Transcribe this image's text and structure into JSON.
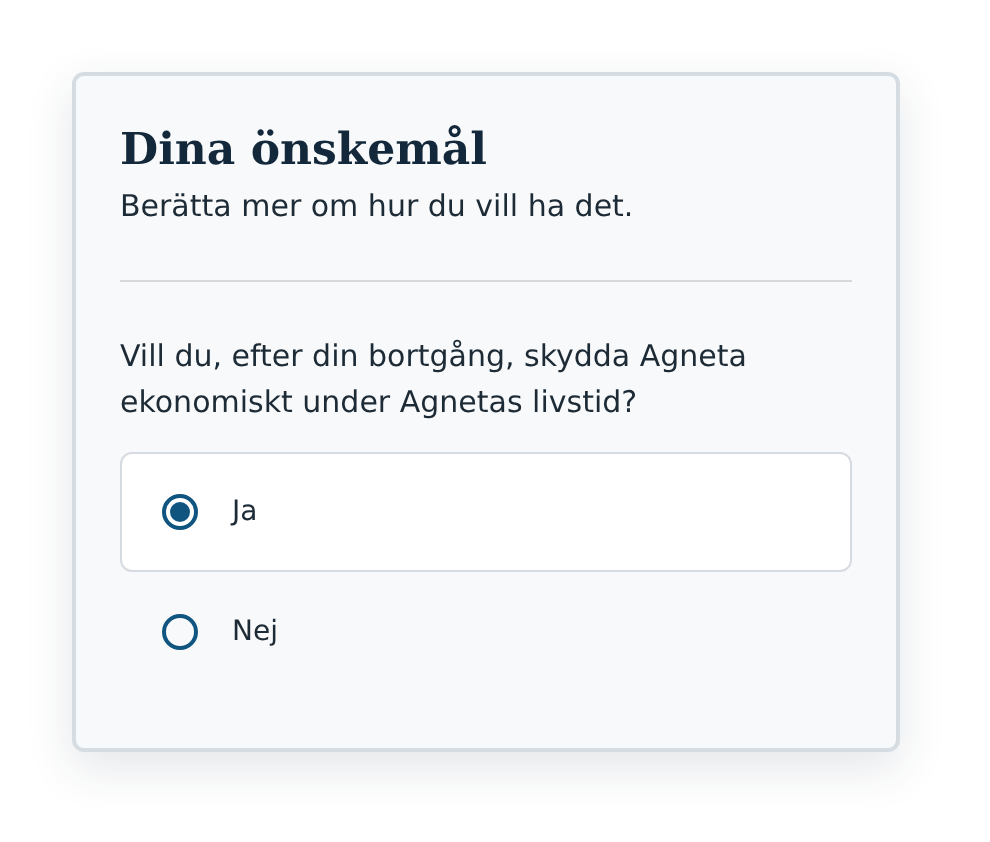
{
  "title": "Dina önskemål",
  "subtitle": "Berätta mer om hur du vill ha det.",
  "question": "Vill du, efter din bortgång, skydda Agneta ekonomiskt under Agnetas livstid?",
  "options": [
    {
      "label": "Ja",
      "selected": true
    },
    {
      "label": "Nej",
      "selected": false
    }
  ]
}
